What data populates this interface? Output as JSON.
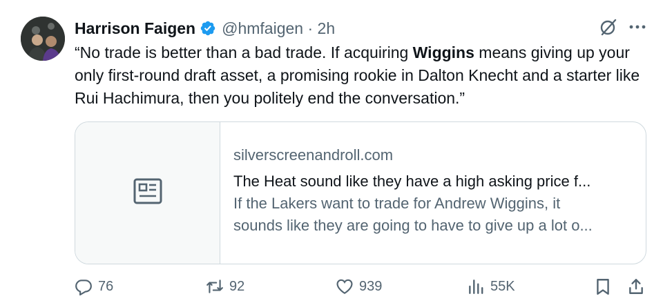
{
  "author": {
    "name": "Harrison Faigen",
    "handle": "@hmfaigen",
    "time": "2h",
    "verified": true
  },
  "tweet": {
    "text_before": "“No trade is better than a bad trade. If acquiring ",
    "text_bold": "Wiggins",
    "text_after": " means giving up your only first-round draft asset, a promising rookie in Dalton Knecht and a starter like Rui Hachimura, then you politely end the conversation.”"
  },
  "card": {
    "domain": "silverscreenandroll.com",
    "title": "The Heat sound like they have a high asking price f...",
    "description_line1": "If the Lakers want to trade for Andrew Wiggins, it",
    "description_line2": "sounds like they are going to have to give up a lot o...",
    "icon": "article-icon"
  },
  "actions": {
    "replies": "76",
    "reposts": "92",
    "likes": "939",
    "views": "55K"
  },
  "colors": {
    "verified": "#1d9bf0",
    "secondary_text": "#536471",
    "border": "#cfd9de"
  }
}
